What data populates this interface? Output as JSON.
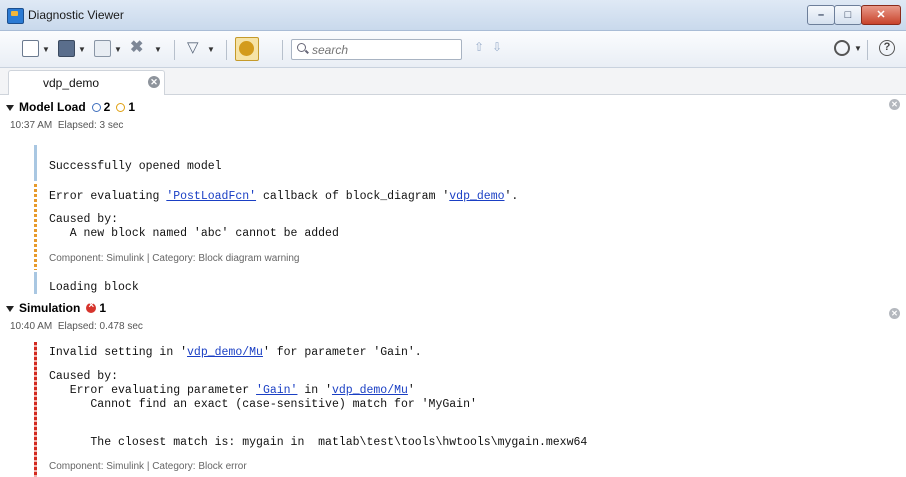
{
  "window": {
    "title": "Diagnostic Viewer"
  },
  "search": {
    "placeholder": "search"
  },
  "tab": {
    "label": "vdp_demo"
  },
  "sections": [
    {
      "title": "Model Load",
      "info_count": "2",
      "warn_count": "1",
      "time": "10:37 AM",
      "elapsed": "Elapsed: 3 sec",
      "messages": {
        "m1": "Successfully opened model",
        "m2_a": "Error evaluating ",
        "m2_link1": "'PostLoadFcn'",
        "m2_b": " callback of block_diagram '",
        "m2_link2": "vdp_demo",
        "m2_c": "'.",
        "caused_by": "Caused by:",
        "cause_line": "   A new block named 'abc' cannot be added",
        "component": "Component: Simulink | Category: Block diagram warning",
        "m3": "Loading block"
      }
    },
    {
      "title": "Simulation",
      "err_count": "1",
      "time": "10:40 AM",
      "elapsed": "Elapsed: 0.478 sec",
      "messages": {
        "m1_a": "Invalid setting in '",
        "m1_link": "vdp_demo/Mu",
        "m1_b": "' for parameter 'Gain'.",
        "caused_by": "Caused by:",
        "c1_a": "   Error evaluating parameter ",
        "c1_link1": "'Gain'",
        "c1_b": " in '",
        "c1_link2": "vdp_demo/Mu",
        "c1_c": "'",
        "c2": "      Cannot find an exact (case-sensitive) match for 'MyGain'",
        "c3": "      The closest match is: mygain in  matlab\\test\\tools\\hwtools\\mygain.mexw64",
        "component": "Component: Simulink | Category: Block error"
      }
    }
  ]
}
